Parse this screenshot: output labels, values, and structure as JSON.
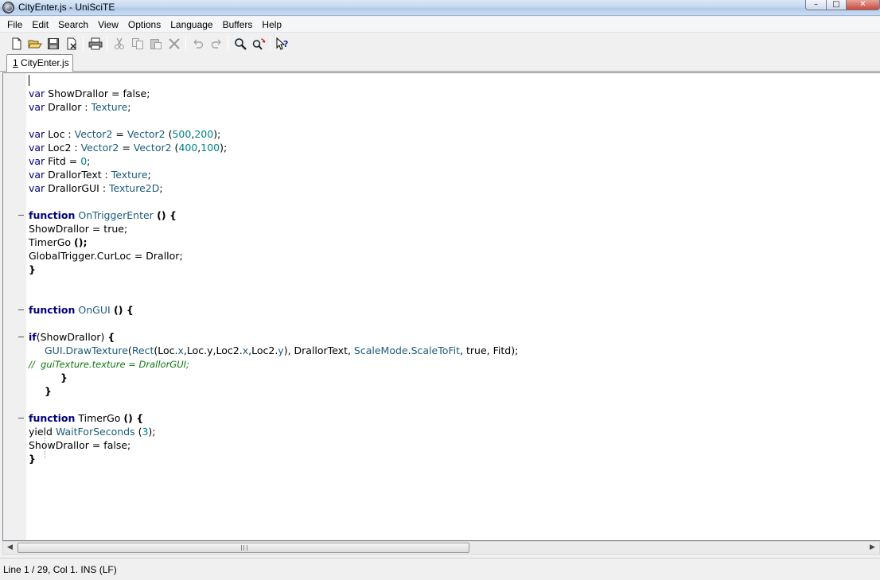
{
  "window": {
    "title": "CityEnter.js - UniSciTE",
    "buttons": {
      "minimize": "–",
      "maximize": "□",
      "close": "✕"
    }
  },
  "menu": [
    "File",
    "Edit",
    "Search",
    "View",
    "Options",
    "Language",
    "Buffers",
    "Help"
  ],
  "toolbar": [
    {
      "name": "new-file-icon",
      "enabled": true
    },
    {
      "name": "open-folder-icon",
      "enabled": true
    },
    {
      "name": "save-icon",
      "enabled": true
    },
    {
      "name": "close-file-icon",
      "enabled": true
    },
    {
      "name": "print-icon",
      "enabled": true
    },
    {
      "name": "cut-icon",
      "enabled": false
    },
    {
      "name": "copy-icon",
      "enabled": false
    },
    {
      "name": "paste-icon",
      "enabled": false
    },
    {
      "name": "delete-icon",
      "enabled": false
    },
    {
      "name": "undo-icon",
      "enabled": false
    },
    {
      "name": "redo-icon",
      "enabled": false
    },
    {
      "name": "find-icon",
      "enabled": true
    },
    {
      "name": "replace-icon",
      "enabled": true
    },
    {
      "name": "context-help-icon",
      "enabled": true
    }
  ],
  "tab": {
    "number": "1",
    "label": "CityEnter.js"
  },
  "code": [
    {
      "fold": false,
      "indent": 0,
      "tokens": []
    },
    {
      "fold": false,
      "indent": 0,
      "tokens": [
        [
          "kw2",
          "var"
        ],
        [
          "p",
          " ShowDrallor = false;"
        ]
      ]
    },
    {
      "fold": false,
      "indent": 0,
      "tokens": [
        [
          "kw2",
          "var"
        ],
        [
          "p",
          " Drallor : "
        ],
        [
          "ty",
          "Texture"
        ],
        [
          "p",
          ";"
        ]
      ]
    },
    {
      "fold": false,
      "indent": 0,
      "tokens": []
    },
    {
      "fold": false,
      "indent": 0,
      "tokens": [
        [
          "kw2",
          "var"
        ],
        [
          "p",
          " Loc : "
        ],
        [
          "ty",
          "Vector2"
        ],
        [
          "p",
          " = "
        ],
        [
          "ty",
          "Vector2"
        ],
        [
          "p",
          " ("
        ],
        [
          "num",
          "500"
        ],
        [
          "p",
          ","
        ],
        [
          "num",
          "200"
        ],
        [
          "p",
          ");"
        ]
      ]
    },
    {
      "fold": false,
      "indent": 0,
      "tokens": [
        [
          "kw2",
          "var"
        ],
        [
          "p",
          " Loc2 : "
        ],
        [
          "ty",
          "Vector2"
        ],
        [
          "p",
          " = "
        ],
        [
          "ty",
          "Vector2"
        ],
        [
          "p",
          " ("
        ],
        [
          "num",
          "400"
        ],
        [
          "p",
          ","
        ],
        [
          "num",
          "100"
        ],
        [
          "p",
          ");"
        ]
      ]
    },
    {
      "fold": false,
      "indent": 0,
      "tokens": [
        [
          "kw2",
          "var"
        ],
        [
          "p",
          " Fitd = "
        ],
        [
          "num",
          "0"
        ],
        [
          "p",
          ";"
        ]
      ]
    },
    {
      "fold": false,
      "indent": 0,
      "tokens": [
        [
          "kw2",
          "var"
        ],
        [
          "p",
          " DrallorText : "
        ],
        [
          "ty",
          "Texture"
        ],
        [
          "p",
          ";"
        ]
      ]
    },
    {
      "fold": false,
      "indent": 0,
      "tokens": [
        [
          "kw2",
          "var"
        ],
        [
          "p",
          " DrallorGUI : "
        ],
        [
          "ty",
          "Texture2D"
        ],
        [
          "p",
          ";"
        ]
      ]
    },
    {
      "fold": false,
      "indent": 0,
      "tokens": []
    },
    {
      "fold": true,
      "indent": 0,
      "tokens": [
        [
          "kw",
          "function"
        ],
        [
          "p",
          " "
        ],
        [
          "ty",
          "OnTriggerEnter"
        ],
        [
          "op",
          " () {"
        ]
      ]
    },
    {
      "fold": false,
      "indent": 0,
      "tokens": [
        [
          "p",
          "ShowDrallor = true;"
        ]
      ]
    },
    {
      "fold": false,
      "indent": 0,
      "tokens": [
        [
          "p",
          "TimerGo "
        ],
        [
          "op",
          "();"
        ]
      ]
    },
    {
      "fold": false,
      "indent": 0,
      "tokens": [
        [
          "p",
          "GlobalTrigger.CurLoc = Drallor;"
        ]
      ]
    },
    {
      "fold": false,
      "indent": 0,
      "tokens": [
        [
          "op",
          "}"
        ]
      ]
    },
    {
      "fold": false,
      "indent": 0,
      "tokens": []
    },
    {
      "fold": false,
      "indent": 0,
      "tokens": []
    },
    {
      "fold": true,
      "indent": 0,
      "tokens": [
        [
          "kw",
          "function"
        ],
        [
          "p",
          " "
        ],
        [
          "ty",
          "OnGUI"
        ],
        [
          "op",
          " () {"
        ]
      ]
    },
    {
      "fold": false,
      "indent": 0,
      "tokens": []
    },
    {
      "fold": true,
      "indent": 0,
      "tokens": [
        [
          "kw",
          "if"
        ],
        [
          "p",
          "(ShowDrallor) "
        ],
        [
          "op",
          "{"
        ]
      ]
    },
    {
      "fold": false,
      "indent": 1,
      "tokens": [
        [
          "ty",
          "GUI"
        ],
        [
          "p",
          "."
        ],
        [
          "ty",
          "DrawTexture"
        ],
        [
          "p",
          "("
        ],
        [
          "ty",
          "Rect"
        ],
        [
          "p",
          "(Loc."
        ],
        [
          "ty",
          "x"
        ],
        [
          "p",
          ",Loc.y,Loc2."
        ],
        [
          "ty",
          "x"
        ],
        [
          "p",
          ",Loc2."
        ],
        [
          "ty",
          "y"
        ],
        [
          "p",
          "), DrallorText, "
        ],
        [
          "ty",
          "ScaleMode"
        ],
        [
          "p",
          "."
        ],
        [
          "ty",
          "ScaleToFit"
        ],
        [
          "p",
          ", true, Fitd);"
        ]
      ]
    },
    {
      "fold": false,
      "indent": 0,
      "tokens": [
        [
          "cm",
          "//  guiTexture.texture = DrallorGUI;"
        ]
      ]
    },
    {
      "fold": false,
      "indent": 2,
      "tokens": [
        [
          "op",
          "}"
        ]
      ]
    },
    {
      "fold": false,
      "indent": 1,
      "tokens": [
        [
          "op",
          "}"
        ]
      ]
    },
    {
      "fold": false,
      "indent": 0,
      "tokens": []
    },
    {
      "fold": true,
      "indent": 0,
      "tokens": [
        [
          "kw",
          "function"
        ],
        [
          "p",
          " TimerGo "
        ],
        [
          "op",
          "() {"
        ]
      ]
    },
    {
      "fold": false,
      "indent": 0,
      "tokens": [
        [
          "p",
          "yield "
        ],
        [
          "ty",
          "WaitForSeconds"
        ],
        [
          "p",
          " ("
        ],
        [
          "num",
          "3"
        ],
        [
          "p",
          ");"
        ]
      ]
    },
    {
      "fold": false,
      "indent": 0,
      "tokens": [
        [
          "p",
          "ShowDrallor = false;"
        ]
      ]
    },
    {
      "fold": false,
      "indent": 0,
      "tokens": [
        [
          "op",
          "}"
        ]
      ]
    }
  ],
  "statusbar": {
    "text": "Line 1 / 29, Col 1. INS (LF)"
  },
  "scrollbar": {
    "left_arrow": "◀",
    "right_arrow": "▶"
  }
}
